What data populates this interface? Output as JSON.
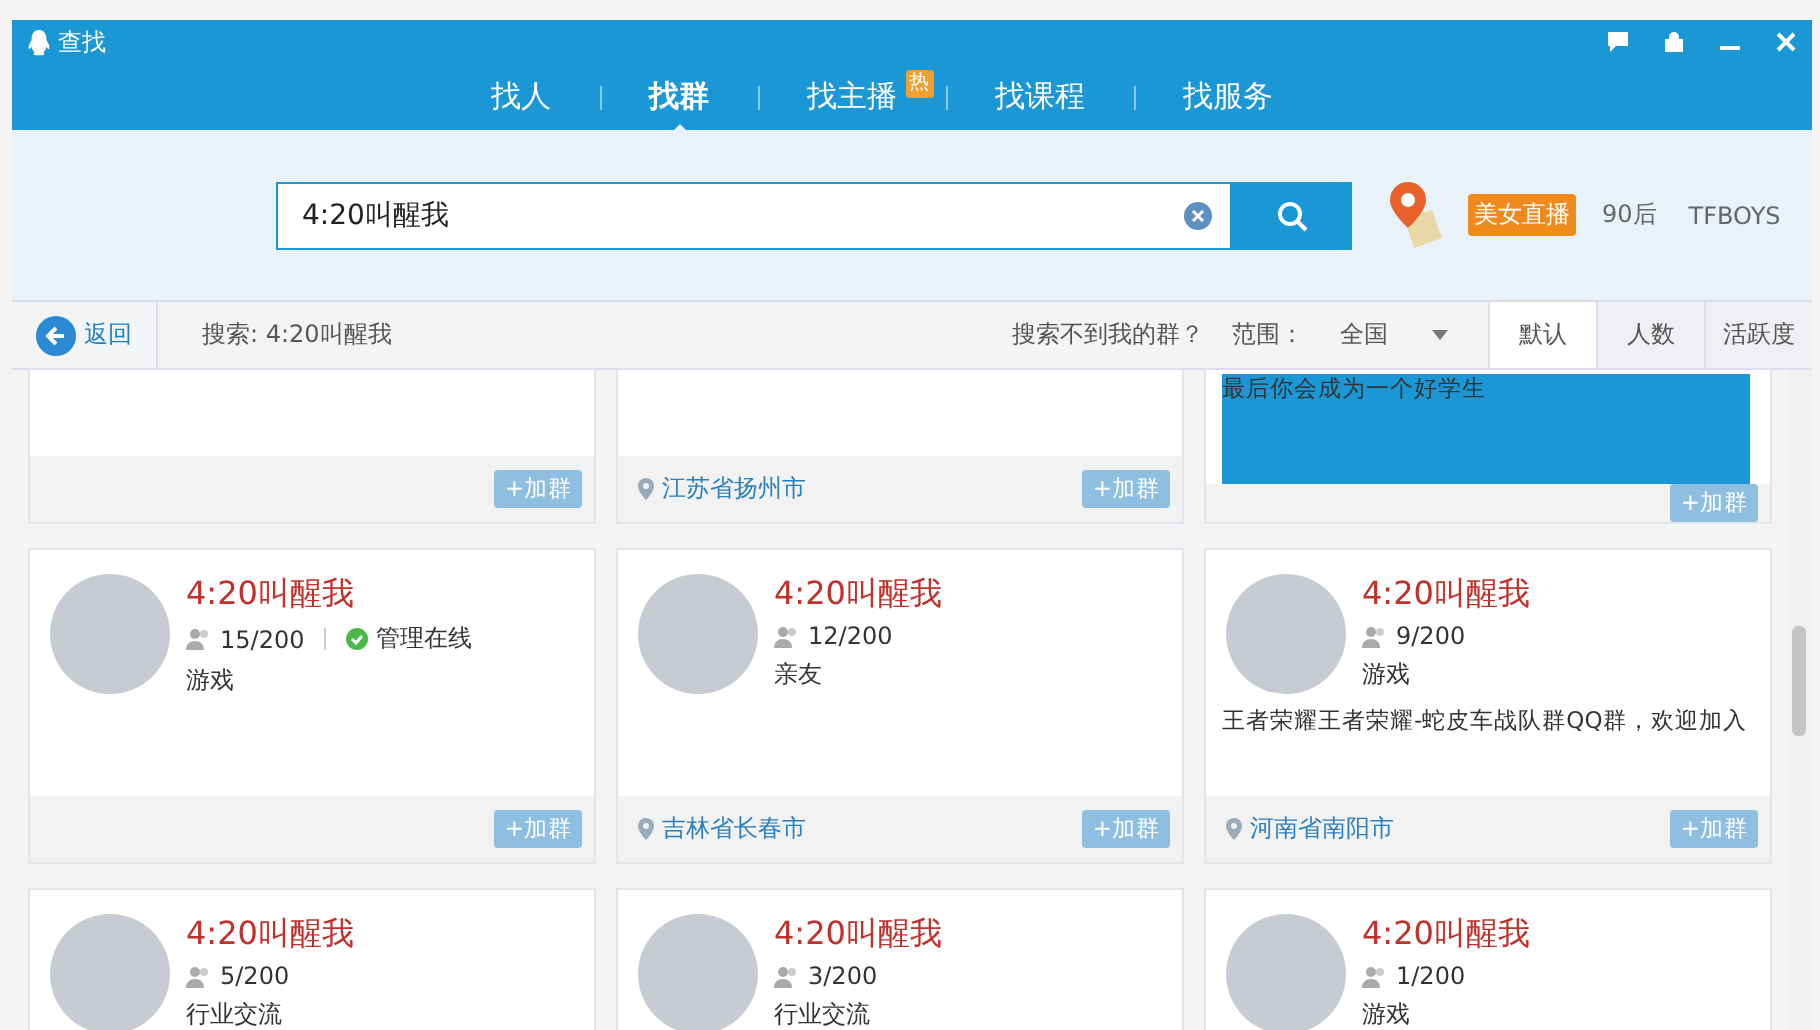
{
  "window": {
    "title": "查找"
  },
  "tabs": [
    {
      "label": "找人",
      "selected": false
    },
    {
      "label": "找群",
      "selected": true
    },
    {
      "label": "找主播",
      "selected": false,
      "badge": "热"
    },
    {
      "label": "找课程",
      "selected": false
    },
    {
      "label": "找服务",
      "selected": false
    }
  ],
  "search": {
    "value": "4:20叫醒我"
  },
  "hot_tags": [
    {
      "label": "美女直播",
      "highlighted": true
    },
    {
      "label": "90后",
      "highlighted": false
    },
    {
      "label": "TFBOYS",
      "highlighted": false
    }
  ],
  "toolbar": {
    "back": "返回",
    "query": "搜索: 4:20叫醒我",
    "hint": "搜索不到我的群？",
    "range_label": "范围：",
    "range_value": "全国"
  },
  "sort_tabs": [
    {
      "label": "默认",
      "selected": true
    },
    {
      "label": "人数",
      "selected": false
    },
    {
      "label": "活跃度",
      "selected": false
    }
  ],
  "cards": [
    {
      "join": "+加群"
    },
    {
      "location": "江苏省扬州市",
      "join": "+加群"
    },
    {
      "description": "最后你会成为一个好学生",
      "join": "+加群"
    },
    {
      "name": "4:20叫醒我",
      "members": "15/200",
      "admin_online": true,
      "admin_text": "管理在线",
      "category": "游戏",
      "join": "+加群"
    },
    {
      "name": "4:20叫醒我",
      "members": "12/200",
      "admin_online": false,
      "category": "亲友",
      "location": "吉林省长春市",
      "join": "+加群"
    },
    {
      "name": "4:20叫醒我",
      "members": "9/200",
      "admin_online": false,
      "category": "游戏",
      "description": "王者荣耀王者荣耀-蛇皮车战队群QQ群，欢迎加入",
      "location": "河南省南阳市",
      "join": "+加群"
    },
    {
      "name": "4:20叫醒我",
      "members": "5/200",
      "admin_online": false,
      "category": "行业交流"
    },
    {
      "name": "4:20叫醒我",
      "members": "3/200",
      "admin_online": false,
      "category": "行业交流"
    },
    {
      "name": "4:20叫醒我",
      "members": "1/200",
      "admin_online": false,
      "category": "游戏"
    }
  ]
}
